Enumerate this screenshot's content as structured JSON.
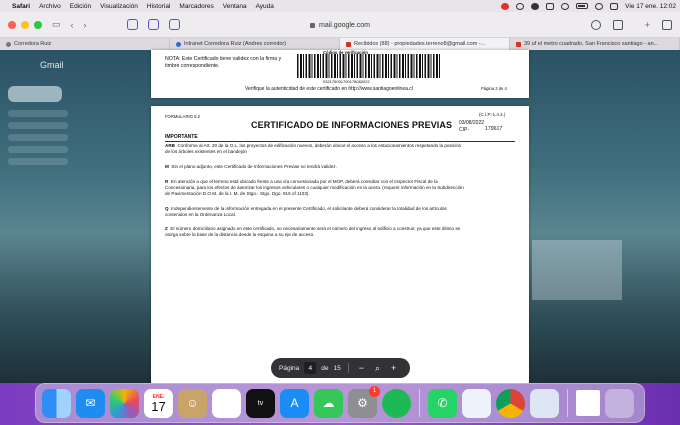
{
  "menubar": {
    "app_name": "Safari",
    "items": [
      "Archivo",
      "Edición",
      "Visualización",
      "Historial",
      "Marcadores",
      "Ventana",
      "Ayuda"
    ],
    "clock": "Vie 17 ene.  12:02"
  },
  "browser": {
    "url": "mail.google.com",
    "tabs": [
      {
        "label": "Corredora Ruiz"
      },
      {
        "label": "Intranet Corredora Ruiz (Andres corredor)"
      },
      {
        "label": "Recibidos (88) - propiedades.terreno8@gmail.com -..."
      },
      {
        "label": "39 uf el metro cuadrado, San Francisco santiago - an..."
      }
    ]
  },
  "gmail": {
    "logo": "Gmail"
  },
  "pdf": {
    "prev_page": {
      "nota": "NOTA: Este Certificado tiene validez con la firma y timbre correspondiente.",
      "barcode_title": "Código de verificación",
      "barcode_number": "032176001790178082022",
      "verify_text": "Verifique la autenticidad de este certificado en http://www.santiagoenlinea.cl",
      "page_label": "Página 3 de 4"
    },
    "current_page": {
      "form_code": "FORMULARIO 5.2",
      "title": "CERTIFICADO DE INFORMACIONES PREVIAS",
      "cip_code": "(C.I.P.-1.4.4.)",
      "date": "03/08/2022",
      "cip_label": "CIP-",
      "cip_number": "179617",
      "importante": "IMPORTANTE",
      "paragraphs": [
        {
          "tag": "ARB",
          "text": "Conforme al Art. 20 de la O.L, los proyectos de edificación nuevos, deberán ubicar el acceso a los estacionamientos respetando la posición de los árboles existentes en el bandejón"
        },
        {
          "tag": "M",
          "text": "Sin el plano adjunto, este Certificado de Informaciones Previas no tendrá validez."
        },
        {
          "tag": "R",
          "text": "En atención a que el terreno está ubicado frente a una vía concesionada por el MOP, deberá consultar con el Inspector Fiscal de la Concesionaria, para los efectos de autorizar los ingresos vehiculares o cualquier modificación en la acera. (requerir información en la Subdirección de Pavimentación D.O.M. de la I. M. de Stgo.- Stgo. Dgo. 916 of 1103)"
        },
        {
          "tag": "Q",
          "text": "Independientemente de la información entregada en el presente Certificado, el solicitante deberá considerar la totalidad de los artículos contenidos en la Ordenanza Local."
        },
        {
          "tag": "Z",
          "text": "El número domiciliario asignado en este certificado, no necesariamente será el número del ingreso al edificio a construir, ya que este último se otorga sobre la base de la distancia desde la esquina a su eje de acceso."
        }
      ]
    },
    "controls": {
      "label": "Página",
      "current": "4",
      "of": "de",
      "total": "15",
      "zoom_out": "−",
      "zoom_in": "+"
    }
  },
  "dock": {
    "calendar_month": "ENE.",
    "calendar_day": "17",
    "settings_badge": "1",
    "tv_label": "tv"
  }
}
